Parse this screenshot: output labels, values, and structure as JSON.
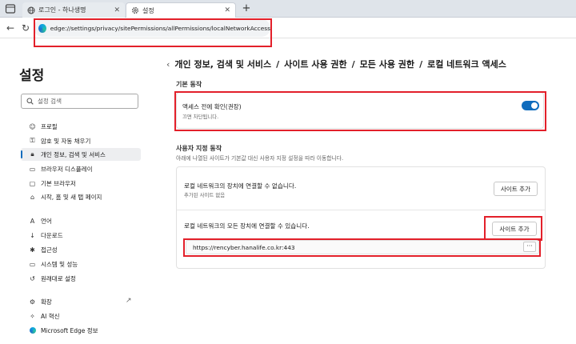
{
  "tabs": [
    {
      "label": "로그인 - 하나생명",
      "close": "✕"
    },
    {
      "label": "설정",
      "close": "✕"
    }
  ],
  "new_tab": "+",
  "address": {
    "url": "edge://settings/privacy/sitePermissions/allPermissions/localNetworkAccess"
  },
  "sidebar": {
    "title": "설정",
    "search_placeholder": "설정 검색",
    "items": [
      {
        "label": "프로필",
        "icon": "profile-icon"
      },
      {
        "label": "암호 및 자동 채우기",
        "icon": "key-icon"
      },
      {
        "label": "개인 정보, 검색 및 서비스",
        "icon": "lock-icon"
      },
      {
        "label": "브라우저 디스플레이",
        "icon": "display-icon"
      },
      {
        "label": "기본 브라우저",
        "icon": "browser-icon"
      },
      {
        "label": "시작, 홈 및 새 탭 페이지",
        "icon": "home-icon"
      },
      {
        "label": "언어",
        "icon": "language-icon"
      },
      {
        "label": "다운로드",
        "icon": "download-icon"
      },
      {
        "label": "접근성",
        "icon": "accessibility-icon"
      },
      {
        "label": "시스템 및 성능",
        "icon": "system-icon"
      },
      {
        "label": "원래대로 설정",
        "icon": "reset-icon"
      },
      {
        "label": "확장",
        "icon": "extension-icon"
      },
      {
        "label": "AI 혁신",
        "icon": "ai-icon"
      },
      {
        "label": "Microsoft Edge 정보",
        "icon": "edge-icon"
      }
    ]
  },
  "main": {
    "breadcrumb": [
      "개인 정보, 검색 및 서비스",
      "/",
      "사이트 사용 권한",
      "/",
      "모든 사용 권한",
      "/",
      "로컬 네트워크 액세스"
    ],
    "default_section": {
      "label": "기본 동작",
      "setting_title": "액세스 전에 확인(권장)",
      "setting_sub": "끄면 차단됩니다.",
      "toggle_on": true
    },
    "custom_section": {
      "label": "사용자 지정 동작",
      "desc": "아래에 나열된 사이트가 기본값 대신 사용자 지정 설정을 따라 이동합니다.",
      "block": {
        "title": "로컬 네트워크의 장치에 연결할 수 없습니다.",
        "sub": "추가된 사이트 없음",
        "button": "사이트 추가"
      },
      "allow": {
        "title": "로컬 네트워크의 모든 장치에 연결할 수 있습니다.",
        "button": "사이트 추가",
        "site": "https://rencyber.hanalife.co.kr:443",
        "more": "···"
      }
    }
  },
  "colors": {
    "accent": "#0f6cbd",
    "highlight": "#e3202a"
  }
}
